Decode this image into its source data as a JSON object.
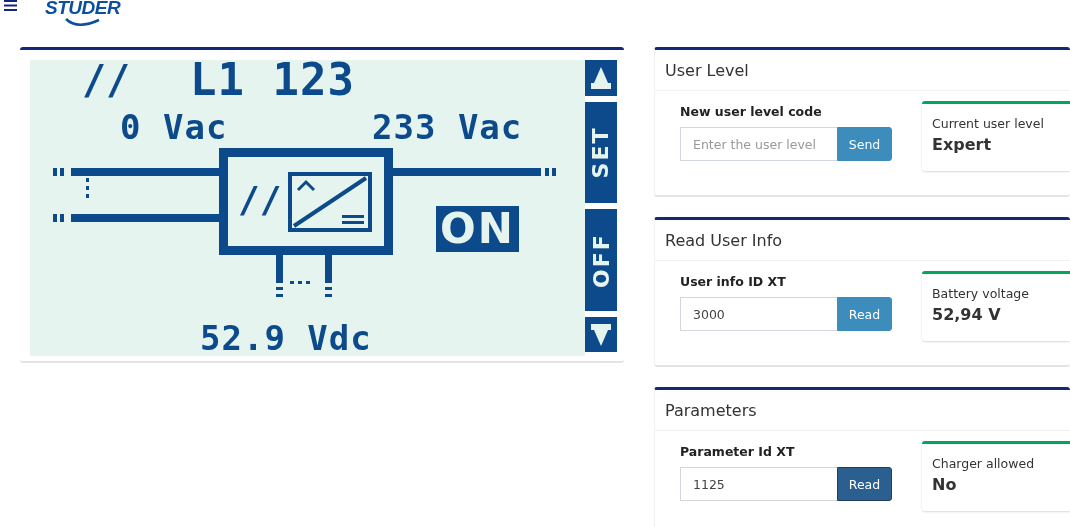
{
  "header": {
    "logo": "STUDER"
  },
  "lcd": {
    "phase_mark": "//",
    "title": "L1 123",
    "input_voltage": "0 Vac",
    "output_voltage": "233 Vac",
    "inverter_mark": "//",
    "state": "ON",
    "battery_voltage": "52.9 Vdc",
    "side_buttons": [
      {
        "kind": "up"
      },
      {
        "kind": "label",
        "label": "SET"
      },
      {
        "kind": "label",
        "label": "OFF"
      },
      {
        "kind": "down"
      }
    ]
  },
  "panels": [
    {
      "title": "User Level",
      "field_label": "New user level code",
      "placeholder": "Enter the user level",
      "button": "Send",
      "pressed": false,
      "info_label": "Current user level",
      "info_value": "Expert"
    },
    {
      "title": "Read User Info",
      "field_label": "User info ID XT",
      "value": "3000",
      "button": "Read",
      "pressed": false,
      "info_label": "Battery voltage",
      "info_value": "52,94 V"
    },
    {
      "title": "Parameters",
      "field_label": "Parameter Id XT",
      "value": "1125",
      "button": "Read",
      "pressed": true,
      "info_label": "Charger allowed",
      "info_value": "No"
    }
  ]
}
